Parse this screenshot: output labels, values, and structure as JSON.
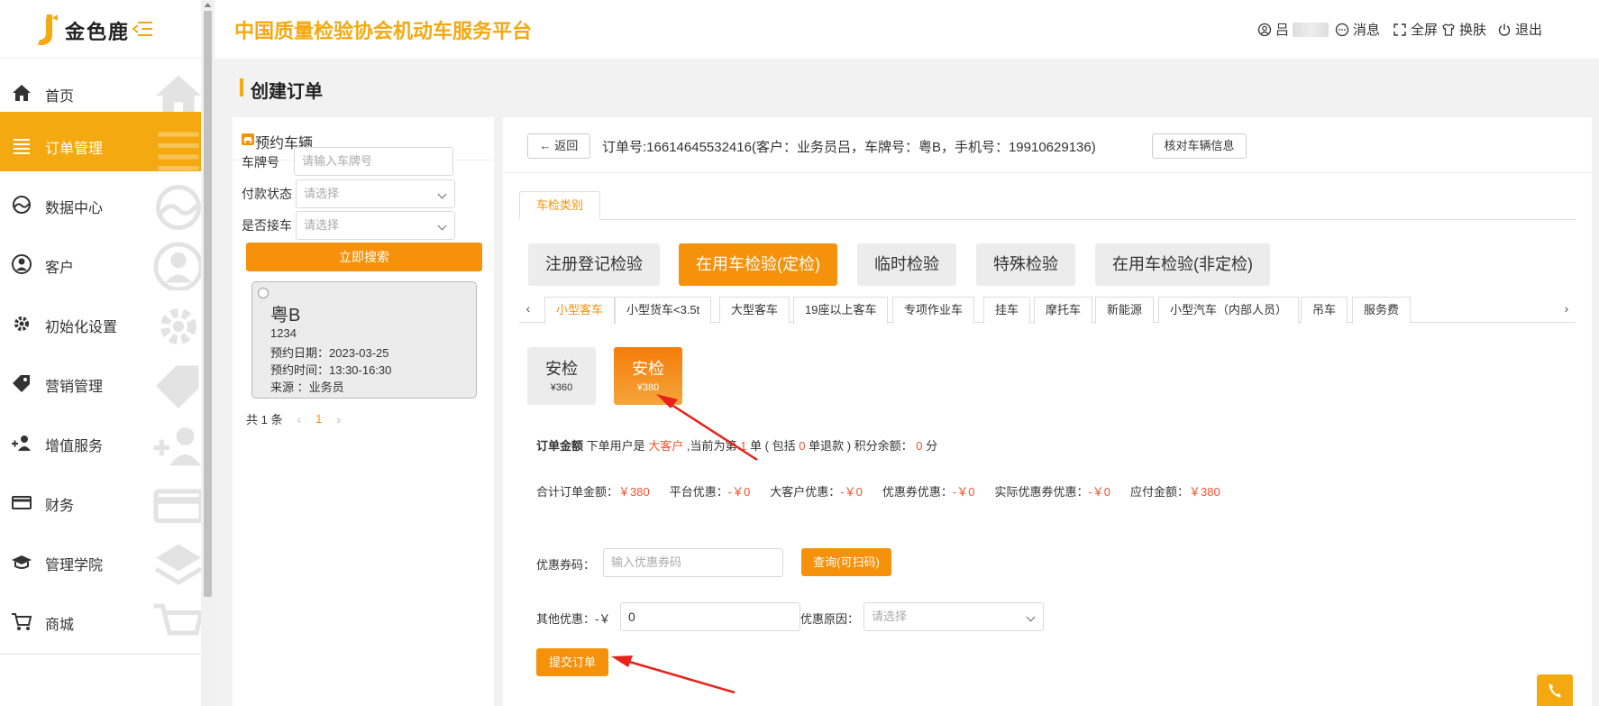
{
  "brand": {
    "name": "金色鹿",
    "color": "#f5a910"
  },
  "header": {
    "title": "中国质量检验协会机动车服务平台",
    "user_label": "吕",
    "messages": "消息",
    "fullscreen": "全屏",
    "skin": "换肤",
    "logout": "退出"
  },
  "sidebar": {
    "items": [
      {
        "label": "首页",
        "icon": "home-icon"
      },
      {
        "label": "订单管理",
        "icon": "list-icon",
        "active": true
      },
      {
        "label": "数据中心",
        "icon": "chart-icon"
      },
      {
        "label": "客户",
        "icon": "user-icon"
      },
      {
        "label": "初始化设置",
        "icon": "gear-icon"
      },
      {
        "label": "营销管理",
        "icon": "tag-icon"
      },
      {
        "label": "增值服务",
        "icon": "user-add-icon"
      },
      {
        "label": "财务",
        "icon": "card-icon"
      },
      {
        "label": "管理学院",
        "icon": "layers-icon"
      },
      {
        "label": "商城",
        "icon": "cart-icon"
      }
    ]
  },
  "page": {
    "title": "创建订单"
  },
  "left_panel": {
    "title": "预约车辆",
    "plate_label": "车牌号",
    "plate_placeholder": "请输入车牌号",
    "pay_label": "付款状态",
    "pay_placeholder": "请选择",
    "pickup_label": "是否接车",
    "pickup_placeholder": "请选择",
    "search_button": "立即搜索",
    "card": {
      "plate": "粤B",
      "number": "1234",
      "date": "预约日期：2023-03-25",
      "time": "预约时间：13:30-16:30",
      "source": "来源 ：业务员"
    },
    "pager": {
      "total": "共 1 条",
      "prev": "‹",
      "page": "1",
      "next": "›"
    }
  },
  "main": {
    "back": "返回",
    "order_info": "订单号:16614645532416(客户：业务员吕，车牌号：粤B，手机号：19910629136)",
    "verify": "核对车辆信息",
    "category_tab": "车检类别",
    "types": [
      "注册登记检验",
      "在用车检验(定检)",
      "临时检验",
      "特殊检验",
      "在用车检验(非定检)"
    ],
    "active_type": 1,
    "subtabs": [
      "小型客车",
      "小型货车<3.5t",
      "大型客车",
      "19座以上客车",
      "专项作业车",
      "挂车",
      "摩托车",
      "新能源",
      "小型汽车（内部人员）",
      "吊车",
      "服务费"
    ],
    "packages": [
      {
        "name": "安检",
        "price": "¥360"
      },
      {
        "name": "安检",
        "price": "¥380",
        "active": true
      }
    ],
    "amount": {
      "label": "订单金额",
      "text1": "下单用户是",
      "customer_type": "大客户",
      "text2": ",当前为第",
      "order_count": "1",
      "text3": "单 ( 包括",
      "refund_count": "0",
      "text4": "单退款 ) 积分余额：",
      "points": "0",
      "text5": "分"
    },
    "totals": [
      {
        "label": "合计订单金额：",
        "value": "￥380"
      },
      {
        "label": "平台优惠：",
        "value": "-￥0"
      },
      {
        "label": "大客户优惠：",
        "value": "-￥0"
      },
      {
        "label": "优惠券优惠：",
        "value": "-￥0"
      },
      {
        "label": "实际优惠券优惠：",
        "value": "-￥0"
      },
      {
        "label": "应付金额：",
        "value": "￥380"
      }
    ],
    "coupon_label": "优惠券码：",
    "coupon_placeholder": "输入优惠券码",
    "query_button": "查询(可扫码)",
    "other_label": "其他优惠：-￥",
    "other_value": "0",
    "reason_label": "优惠原因：",
    "reason_placeholder": "请选择",
    "submit": "提交订单"
  },
  "colors": {
    "accent": "#f5910a",
    "highlight": "#f5522d",
    "annotation_arrow": "#e8221a"
  }
}
